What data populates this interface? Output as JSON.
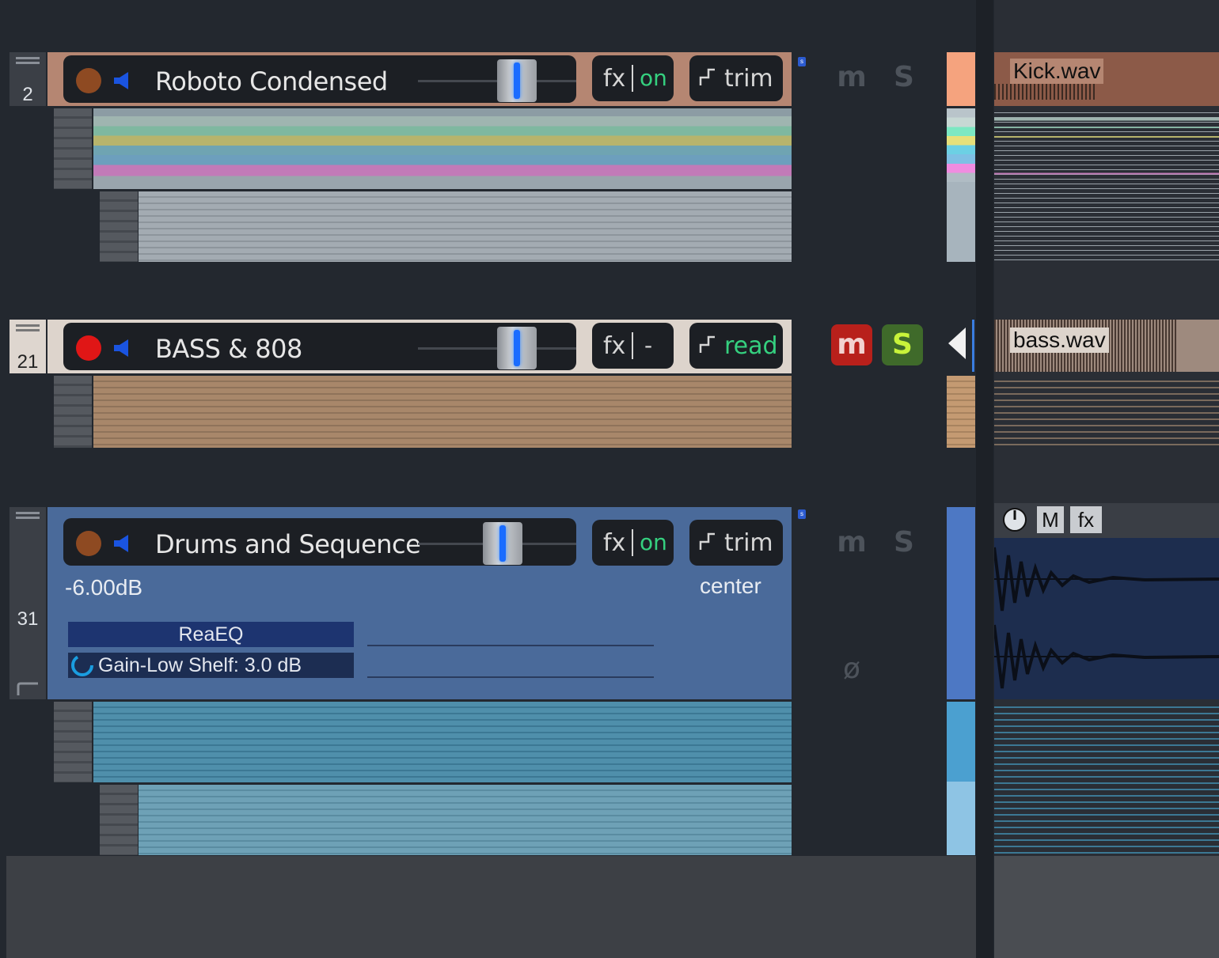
{
  "tracks": [
    {
      "number": "2",
      "name": "Roboto Condensed",
      "fx_label": "fx",
      "fx_state": "on",
      "auto_mode": "trim",
      "mute_label": "m",
      "solo_label": "S",
      "clip_name": "Kick.wav",
      "header_color": "#b58672",
      "record_color": "#9a4a1e",
      "lane_colors": [
        "#8c9ca4",
        "#9fb5b0",
        "#7fb8a0",
        "#b7b46c",
        "#6fa4b2",
        "#6d9fbd",
        "#c27ab8",
        "#9aa5ad",
        "#a4acb3",
        "#9aa2a9",
        "#a6aeb6",
        "#99a1a8",
        "#a2aab1",
        "#979fa6",
        "#a6aeb6",
        "#9da5ac",
        "#a3abb2",
        "#9ba3aa",
        "#a1a9b0",
        "#9aa2a9",
        "#a4acb3",
        "#99a1a8"
      ]
    },
    {
      "number": "21",
      "name": "BASS & 808",
      "fx_label": "fx",
      "fx_state": "-",
      "auto_mode": "read",
      "mute_label": "m",
      "solo_label": "S",
      "clip_name": "bass.wav",
      "header_color": "#ddd4cc",
      "record_color": "#e01616",
      "lane_colors": [
        "#a8876a",
        "#9e7f63",
        "#a8876a",
        "#9e7f63",
        "#a8876a",
        "#9e7f63",
        "#a8876a",
        "#9e7f63",
        "#a8876a",
        "#9e7f63",
        "#a8876a"
      ]
    },
    {
      "number": "31",
      "name": "Drums and Sequence",
      "fx_label": "fx",
      "fx_state": "on",
      "auto_mode": "trim",
      "mute_label": "m",
      "solo_label": "S",
      "volume": "-6.00dB",
      "pan": "center",
      "phase_symbol": "ø",
      "fx_chain": [
        "ReaEQ"
      ],
      "param_lane": "Gain-Low Shelf: 3.0 dB",
      "clip_buttons": [
        "M",
        "fx"
      ],
      "header_color": "#4a6a9a",
      "record_color": "#9a4a1e"
    }
  ],
  "colors": {
    "accent_green": "#35d07f",
    "mute_active": "#c8221c",
    "solo_active": "#b8e62a",
    "fader_glow": "#1a6cff"
  }
}
